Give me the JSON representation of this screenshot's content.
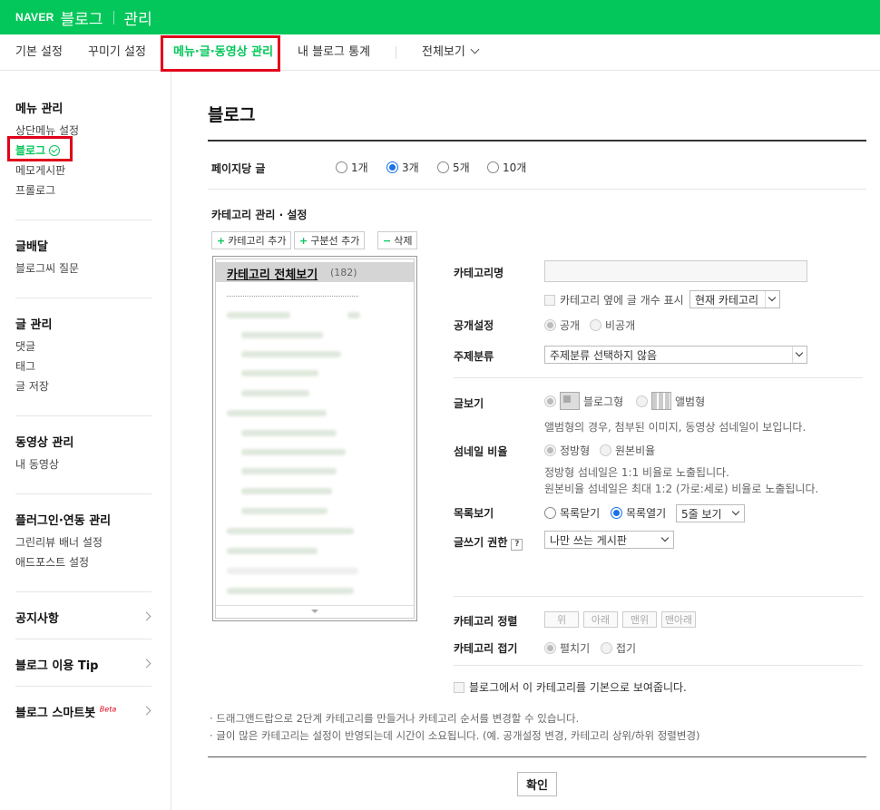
{
  "topbar": {
    "naver": "NAVER",
    "blog": "블로그",
    "manage": "관리"
  },
  "tabs": {
    "basic": "기본 설정",
    "decor": "꾸미기 설정",
    "menu": "메뉴·글·동영상 관리",
    "stats": "내 블로그 통계",
    "all": "전체보기"
  },
  "sidebar": {
    "menu_title": "메뉴 관리",
    "menu_items": [
      "상단메뉴 설정",
      "블로그",
      "메모게시판",
      "프롤로그"
    ],
    "post_dist_title": "글배달",
    "post_dist_items": [
      "블로그씨 질문"
    ],
    "post_mgmt_title": "글 관리",
    "post_mgmt_items": [
      "댓글",
      "태그",
      "글 저장"
    ],
    "video_title": "동영상 관리",
    "video_items": [
      "내 동영상"
    ],
    "plugin_title": "플러그인·연동 관리",
    "plugin_items": [
      "그린리뷰 배너 설정",
      "애드포스트 설정"
    ],
    "notice": "공지사항",
    "tip": "블로그 이용 Tip",
    "smartbot": "블로그 스마트봇",
    "smartbot_badge": "Beta"
  },
  "main": {
    "title": "블로그",
    "per_page_label": "페이지당 글",
    "per_page_options": [
      "1개",
      "3개",
      "5개",
      "10개"
    ],
    "per_page_selected": "3개",
    "cat_section": "카테고리 관리 · 설정",
    "btn_add_cat": "카테고리 추가",
    "btn_add_div": "구분선 추가",
    "btn_delete": "삭제",
    "tree_all": "카테고리 전체보기",
    "tree_count": "(182)",
    "cat_name_label": "카테고리명",
    "cat_name_value": "",
    "show_count_label": "카테고리 옆에 글 개수 표시",
    "show_count_select": "현재 카테고리",
    "public_label": "공개설정",
    "public_on": "공개",
    "public_off": "비공개",
    "topic_label": "주제분류",
    "topic_select": "주제분류 선택하지 않음",
    "view_label": "글보기",
    "view_blog": "블로그형",
    "view_album": "앨범형",
    "view_note": "앨범형의 경우, 첨부된 이미지, 동영상 섬네일이 보입니다.",
    "thumb_label": "섬네일 비율",
    "thumb_square": "정방형",
    "thumb_original": "원본비율",
    "thumb_note1": "정방형 섬네일은 1:1 비율로 노출됩니다.",
    "thumb_note2": "원본비율 섬네일은 최대 1:2 (가로:세로) 비율로 노출됩니다.",
    "list_label": "목록보기",
    "list_close": "목록닫기",
    "list_open": "목록열기",
    "list_select": "5줄 보기",
    "write_label": "글쓰기 권한",
    "write_help": "?",
    "write_select": "나만 쓰는 게시판",
    "sort_label": "카테고리 정렬",
    "sort_buttons": [
      "위",
      "아래",
      "맨위",
      "맨아래"
    ],
    "fold_label": "카테고리 접기",
    "fold_open": "펼치기",
    "fold_close": "접기",
    "default_label": "블로그에서 이 카테고리를 기본으로 보여줍니다.",
    "hint1": "· 드래그앤드랍으로 2단계 카테고리를 만들거나 카테고리 순서를 변경할 수 있습니다.",
    "hint2": "· 글이 많은 카테고리는 설정이 반영되는데 시간이 소요됩니다. (예. 공개설정 변경, 카테고리 상위/하위 정렬변경)",
    "confirm": "확인"
  },
  "colors": {
    "brand": "#03c75a",
    "highlight": "#e1001a",
    "radio": "#1a73e8"
  }
}
